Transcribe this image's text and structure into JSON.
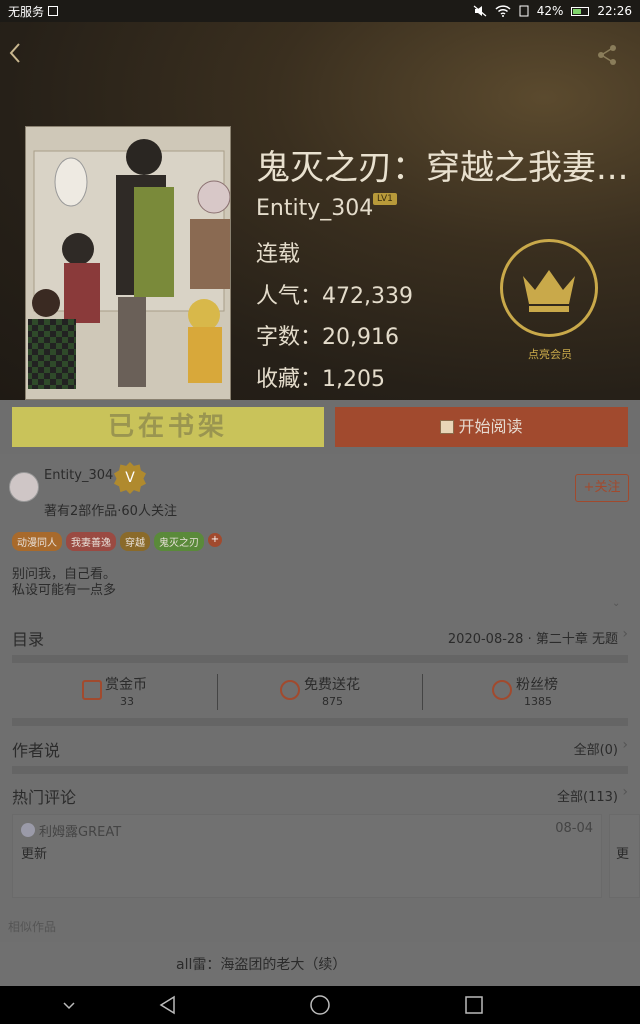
{
  "status_bar": {
    "carrier": "无服务",
    "battery": "42%",
    "time": "22:26"
  },
  "header": {
    "title": "鬼灭之刃：穿越之我妻...",
    "author": "Entity_304",
    "author_level": "LV1",
    "status": "连载",
    "popularity": "人气：472,339",
    "word_count": "字数：20,916",
    "favorites": "收藏：1,205",
    "vip_label": "点亮会员"
  },
  "actions": {
    "shelf_label": "已在书架",
    "read_label": "开始阅读"
  },
  "author_info": {
    "name": "Entity_304",
    "badge": "V",
    "meta": "著有2部作品·60人关注",
    "follow_label": "+关注"
  },
  "tags": [
    {
      "label": "动漫同人",
      "color": "#a86a2c"
    },
    {
      "label": "我妻善逸",
      "color": "#9a4a42"
    },
    {
      "label": "穿越",
      "color": "#8a6a2a"
    },
    {
      "label": "鬼灭之刃",
      "color": "#5a8a3a"
    }
  ],
  "description": {
    "line1": "别问我，自己看。",
    "line2": "私设可能有一点多"
  },
  "catalog": {
    "label": "目录",
    "latest": "2020-08-28 · 第二十章 无题"
  },
  "rewards": [
    {
      "label": "赏金币",
      "count": "33"
    },
    {
      "label": "免费送花",
      "count": "875"
    },
    {
      "label": "粉丝榜",
      "count": "1385"
    }
  ],
  "author_says": {
    "label": "作者说",
    "all": "全部(0)"
  },
  "hot_comments": {
    "label": "热门评论",
    "all": "全部(113)",
    "items": [
      {
        "user": "利姆露GREAT",
        "date": "08-04",
        "body": "更新"
      },
      {
        "body": "更"
      }
    ]
  },
  "similar": {
    "label": "相似作品",
    "items": [
      {
        "title": "all雷：海盗团的老大（续）"
      }
    ]
  },
  "colors": {
    "accent": "#a14a2e",
    "shelf_button": "#c9c35a",
    "vip_gold": "#c9a94a"
  }
}
